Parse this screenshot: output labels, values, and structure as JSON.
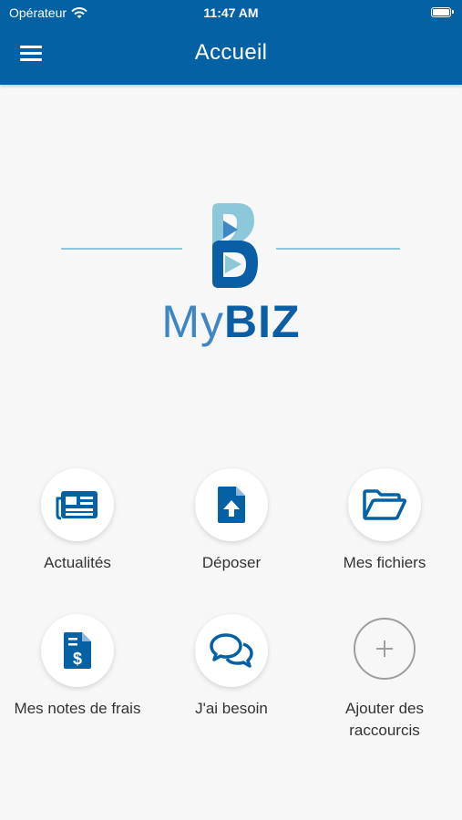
{
  "status_bar": {
    "carrier": "Opérateur",
    "time": "11:47 AM",
    "battery_level": 1.0
  },
  "header": {
    "title": "Accueil"
  },
  "logo": {
    "text_my": "My",
    "text_biz": "BIZ"
  },
  "shortcuts": [
    {
      "label": "Actualités",
      "icon": "newspaper-icon"
    },
    {
      "label": "Déposer",
      "icon": "file-upload-icon"
    },
    {
      "label": "Mes fichiers",
      "icon": "folder-open-icon"
    },
    {
      "label": "Mes notes de frais",
      "icon": "expense-file-icon"
    },
    {
      "label": "J'ai besoin",
      "icon": "chat-bubbles-icon"
    },
    {
      "label": "Ajouter des raccourcis",
      "icon": "plus-icon"
    }
  ],
  "colors": {
    "primary": "#0461a3",
    "logo_light": "#8cc8d9",
    "background": "#f7f7f7"
  }
}
